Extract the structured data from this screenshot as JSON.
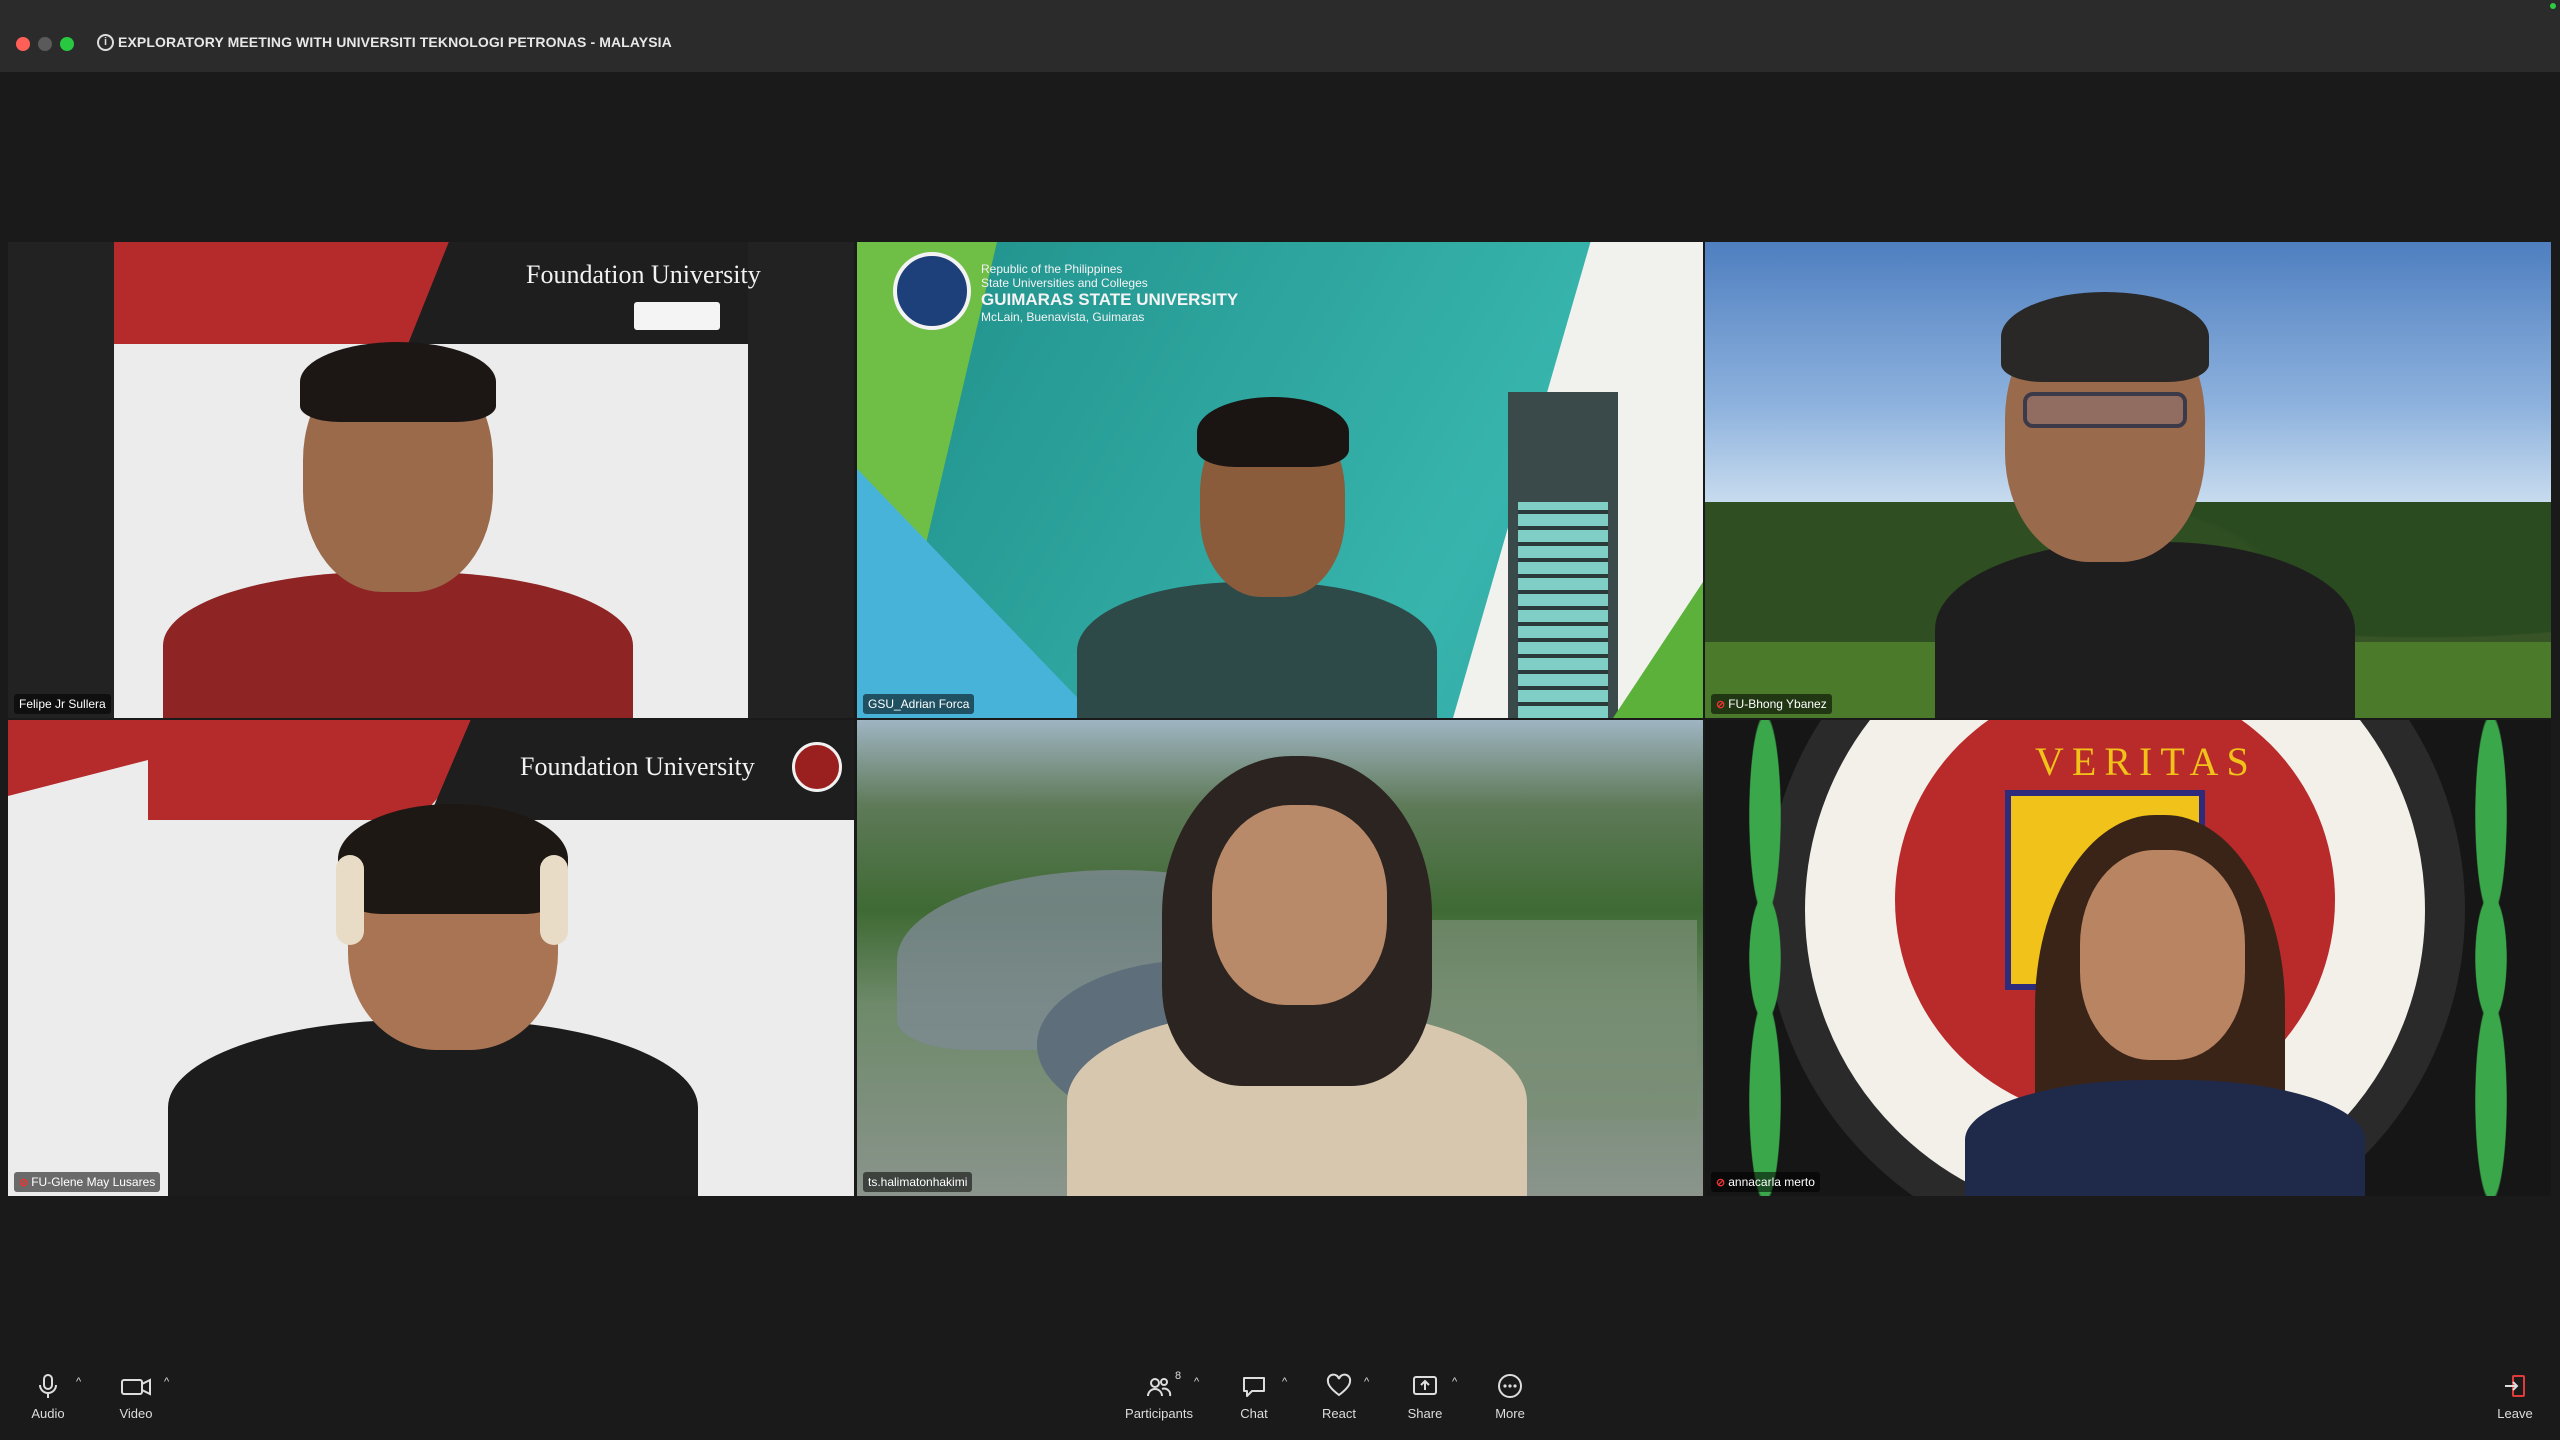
{
  "window": {
    "meeting_title": "EXPLORATORY MEETING WITH UNIVERSITI TEKNOLOGI PETRONAS - MALAYSIA"
  },
  "tiles": [
    {
      "name": "Felipe Jr Sullera",
      "muted": false,
      "active": true,
      "backdrop_text": "Foundation University"
    },
    {
      "name": "GSU_Adrian Forca",
      "muted": false,
      "active": false,
      "backdrop_lines": [
        "Republic of the Philippines",
        "State Universities and Colleges",
        "GUIMARAS STATE UNIVERSITY",
        "McLain, Buenavista, Guimaras"
      ]
    },
    {
      "name": "FU-Bhong Ybanez",
      "muted": true,
      "active": false
    },
    {
      "name": "FU-Glene May Lusares",
      "muted": true,
      "active": false,
      "backdrop_text": "Foundation University"
    },
    {
      "name": "ts.halimatonhakimi",
      "muted": false,
      "active": false
    },
    {
      "name": "annacarla merto",
      "muted": true,
      "active": false,
      "backdrop_text": "VERITAS"
    }
  ],
  "toolbar": {
    "audio": "Audio",
    "video": "Video",
    "participants": "Participants",
    "participants_count": "8",
    "chat": "Chat",
    "react": "React",
    "share": "Share",
    "more": "More",
    "leave": "Leave"
  },
  "colors": {
    "active_speaker": "#3fbf3f",
    "muted": "#e33333",
    "fu_red": "#b52a2a",
    "gsu_teal": "#2fa7a0",
    "leave": "#e03b3b"
  }
}
